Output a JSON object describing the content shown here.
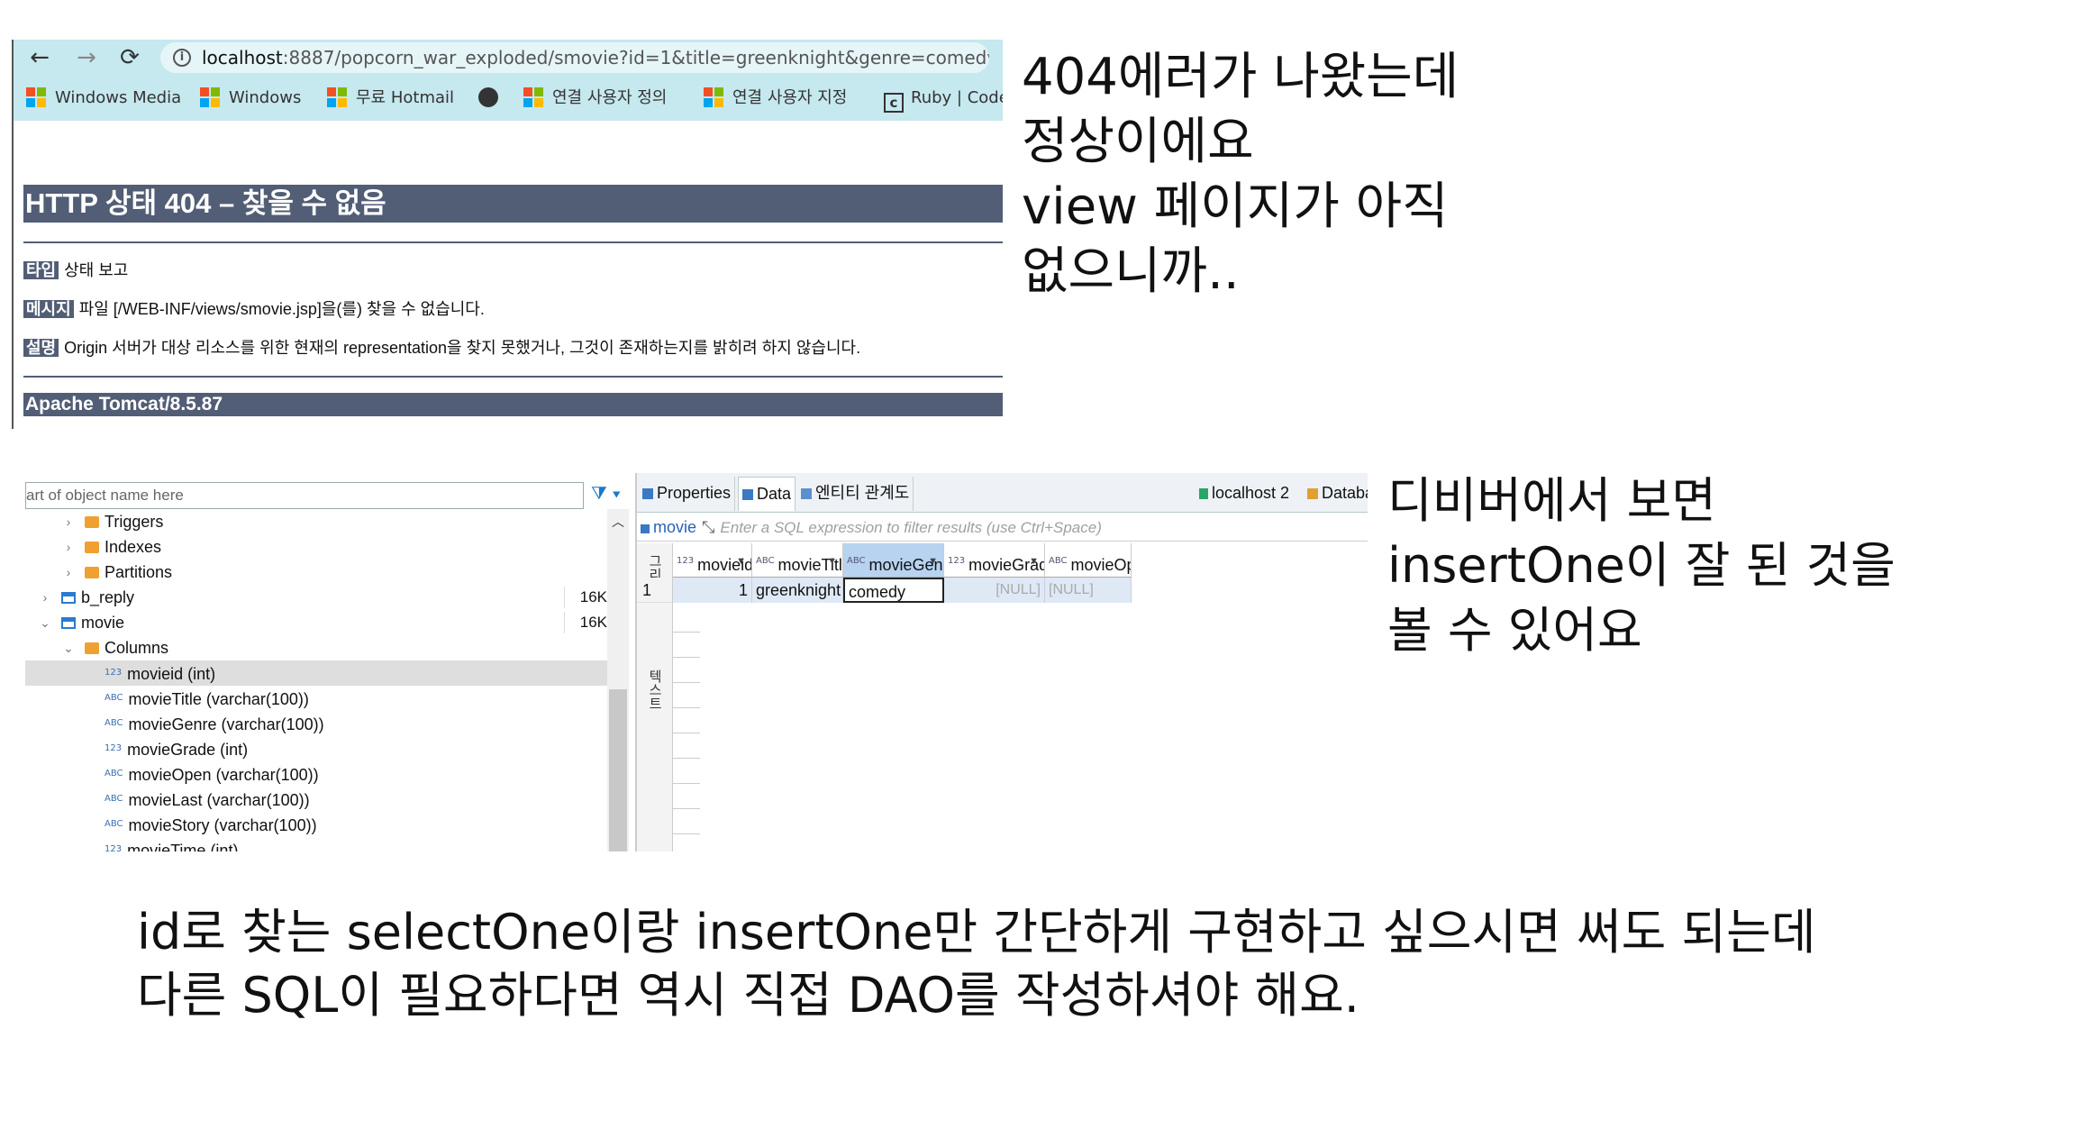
{
  "browser": {
    "url_host": "localhost",
    "url_rest": ":8887/popcorn_war_exploded/smovie?id=1&title=greenknight&genre=comedy",
    "bookmarks": [
      "Windows Media",
      "Windows",
      "무료 Hotmail",
      "",
      "연결 사용자 정의",
      "연결 사용자 지정",
      "Ruby | Code"
    ],
    "error": {
      "title": "HTTP 상태 404 – 찾을 수 없음",
      "type_label": "타입",
      "type_text": "상태 보고",
      "message_label": "메시지",
      "message_text": "파일 [/WEB-INF/views/smovie.jsp]을(를) 찾을 수 없습니다.",
      "desc_label": "설명",
      "desc_text": "Origin 서버가 대상 리소스를 위한 현재의 representation을 찾지 못했거나, 그것이 존재하는지를 밝히려 하지 않습니다.",
      "footer": "Apache Tomcat/8.5.87"
    }
  },
  "notes": {
    "note1": [
      "404에러가 나왔는데",
      "정상이에요",
      "view 페이지가 아직",
      "없으니까.."
    ],
    "note2": [
      "디비버에서 보면",
      "insertOne이 잘 된 것을",
      "볼 수 있어요"
    ],
    "note3": [
      "id로 찾는 selectOne이랑 insertOne만 간단하게 구현하고 싶으시면 써도 되는데",
      "다른 SQL이 필요하다면 역시 직접 DAO를 작성하셔야 해요."
    ]
  },
  "dbeaver": {
    "filter_placeholder": "art of object name here",
    "tree": [
      {
        "label": "Triggers",
        "kind": "folder",
        "twisty": "›"
      },
      {
        "label": "Indexes",
        "kind": "folder",
        "twisty": "›"
      },
      {
        "label": "Partitions",
        "kind": "folder",
        "twisty": "›"
      },
      {
        "label": "b_reply",
        "kind": "table",
        "twisty": "›",
        "size": "16K"
      },
      {
        "label": "movie",
        "kind": "table",
        "twisty": "⌄",
        "size": "16K"
      },
      {
        "label": "Columns",
        "kind": "folder",
        "twisty": "⌄"
      },
      {
        "label": "movieid (int)",
        "kind": "num"
      },
      {
        "label": "movieTitle (varchar(100))",
        "kind": "str"
      },
      {
        "label": "movieGenre (varchar(100))",
        "kind": "str"
      },
      {
        "label": "movieGrade (int)",
        "kind": "num"
      },
      {
        "label": "movieOpen (varchar(100))",
        "kind": "str"
      },
      {
        "label": "movieLast (varchar(100))",
        "kind": "str"
      },
      {
        "label": "movieStory (varchar(100))",
        "kind": "str"
      },
      {
        "label": "movieTime (int)",
        "kind": "num"
      }
    ],
    "tabs": [
      "Properties",
      "Data",
      "엔티티 관계도"
    ],
    "connection": "localhost 2",
    "database_tab": "Databa",
    "table_name": "movie",
    "filter_hint": "Enter a SQL expression to filter results (use Ctrl+Space)",
    "side_labels": [
      "그리드",
      "텍스트"
    ],
    "columns": [
      "movieid",
      "movieTitle",
      "movieGenre",
      "movieGrade",
      "movieOpen"
    ],
    "row": {
      "num": "1",
      "movieid": "1",
      "movieTitle": "greenknight",
      "movieGenre": "comedy",
      "movieGrade": "[NULL]",
      "movieOpen": "[NULL]"
    }
  }
}
